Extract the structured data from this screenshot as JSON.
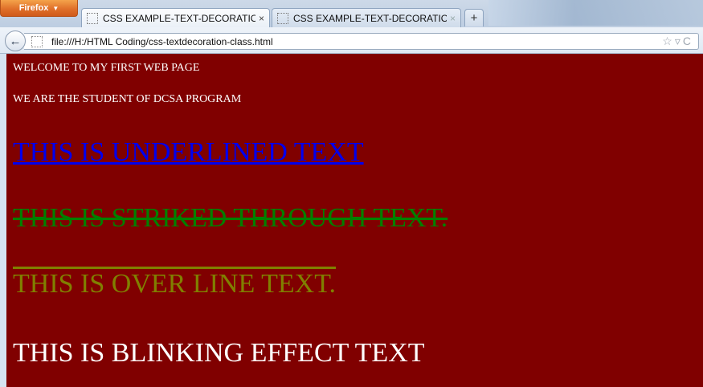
{
  "browser": {
    "app_button": "Firefox",
    "tabs": [
      {
        "title": "CSS EXAMPLE-TEXT-DECORATION U...",
        "close": "×"
      },
      {
        "title": "CSS EXAMPLE-TEXT-DECORATION",
        "close": "×"
      }
    ],
    "new_tab": "+",
    "back": "←",
    "url": "file:///H:/HTML Coding/css-textdecoration-class.html",
    "url_icons": "☆▿C"
  },
  "page": {
    "line1": "WELCOME TO MY FIRST WEB PAGE",
    "line2": "WE ARE THE STUDENT OF DCSA PROGRAM",
    "underlined": "THIS IS UNDERLINED TEXT",
    "striked": "THIS IS STRIKED THROUGH TEXT.",
    "overline": "THIS IS OVER LINE TEXT.",
    "blinking": "THIS IS BLINKING EFFECT TEXT"
  },
  "colors": {
    "page_background": "#800000",
    "underlined_text": "#0000ee",
    "striked_text": "#008000",
    "overline_text": "#808000",
    "plain_text": "#ffffff"
  }
}
